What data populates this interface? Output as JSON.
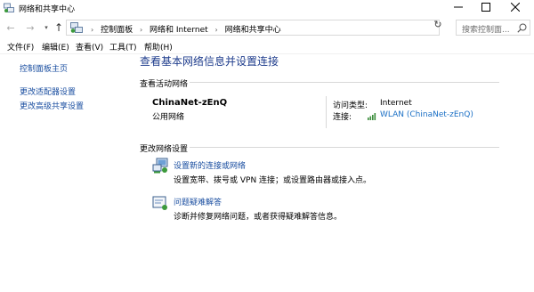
{
  "window": {
    "title": "网络和共享中心",
    "controls": {
      "minimize": "minimize",
      "maximize": "maximize",
      "close": "close"
    }
  },
  "navigation": {
    "breadcrumbs": [
      "控制面板",
      "网络和 Internet",
      "网络和共享中心"
    ],
    "search_placeholder": "搜索控制面..."
  },
  "menu": [
    "文件(F)",
    "编辑(E)",
    "查看(V)",
    "工具(T)",
    "帮助(H)"
  ],
  "sidebar": {
    "items": [
      {
        "label": "控制面板主页"
      },
      {
        "label": "更改适配器设置"
      },
      {
        "label": "更改高级共享设置"
      }
    ]
  },
  "main": {
    "heading": "查看基本网络信息并设置连接",
    "active_networks": {
      "label": "查看活动网络",
      "network_name": "ChinaNet-zEnQ",
      "network_type": "公用网络",
      "access_type_label": "访问类型:",
      "access_type_value": "Internet",
      "connection_label": "连接:",
      "connection_value": "WLAN (ChinaNet-zEnQ)"
    },
    "change_settings": {
      "label": "更改网络设置",
      "tasks": [
        {
          "title": "设置新的连接或网络",
          "description": "设置宽带、拨号或 VPN 连接；或设置路由器或接入点。",
          "icon": "network-setup-icon"
        },
        {
          "title": "问题疑难解答",
          "description": "诊断并修复网络问题，或者获得疑难解答信息。",
          "icon": "troubleshoot-icon"
        }
      ]
    }
  },
  "colors": {
    "heading": "#1e3c8c",
    "link": "#1a4ea0",
    "wlan_link": "#1a6fc5"
  }
}
